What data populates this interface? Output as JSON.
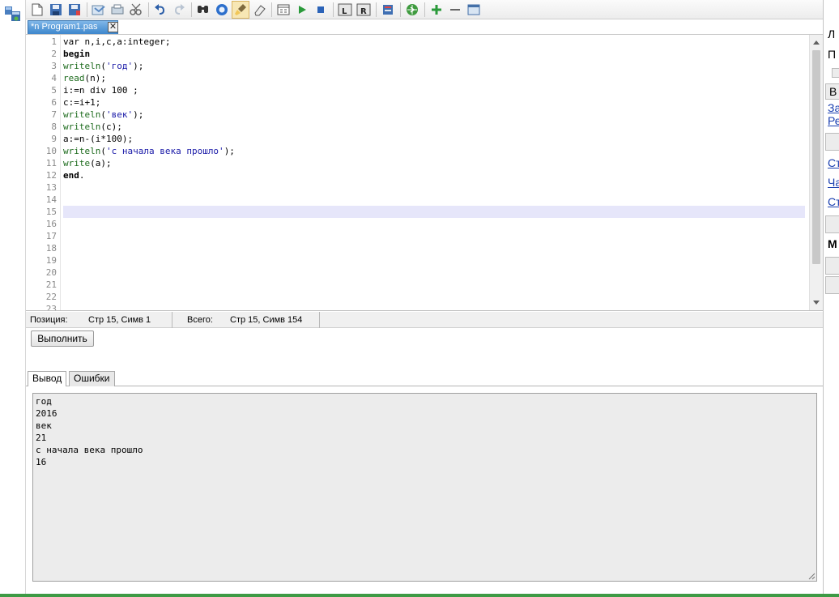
{
  "toolbar": {
    "buttons": [
      "new-file",
      "open-file",
      "save",
      "save-all",
      "undo",
      "redo",
      "find",
      "replace",
      "format",
      "clear",
      "debug",
      "run",
      "stop",
      "step-into",
      "step-over",
      "compile",
      "browse",
      "add",
      "remove",
      "window"
    ]
  },
  "tab": {
    "title": "*n Program1.pas",
    "close": "✕"
  },
  "editor": {
    "line_numbers": [
      "1",
      "2",
      "3",
      "4",
      "5",
      "6",
      "7",
      "8",
      "9",
      "10",
      "11",
      "12",
      "13",
      "14",
      "15",
      "16",
      "17",
      "18",
      "19",
      "20",
      "21",
      "22",
      "23"
    ],
    "lines": [
      "var n,i,c,a:integer;",
      "begin",
      "writeln('год');",
      "read(n);",
      "i:=n div 100 ;",
      "c:=i+1;",
      "writeln('век');",
      "writeln(c);",
      "a:=n-(i*100);",
      "writeln('с начала века прошло');",
      "write(a);",
      "end."
    ],
    "current_line": 15
  },
  "status": {
    "position_label": "Позиция:",
    "position_value": "Стр 15, Симв 1",
    "total_label": "Всего:",
    "total_value": "Стр 15, Симв 154"
  },
  "run_button": "Выполнить",
  "output_tabs": {
    "output": "Вывод",
    "errors": "Ошибки"
  },
  "output_lines": [
    "год",
    "2016",
    "век",
    "21",
    "с начала века прошло",
    "16"
  ],
  "right_panel": {
    "text1": "Л",
    "text2": "П",
    "btn": "В",
    "link1": "За",
    "link2": "Ре",
    "link3": "Ст",
    "link4": "Ча",
    "link5": "Ст",
    "bold": "М"
  }
}
